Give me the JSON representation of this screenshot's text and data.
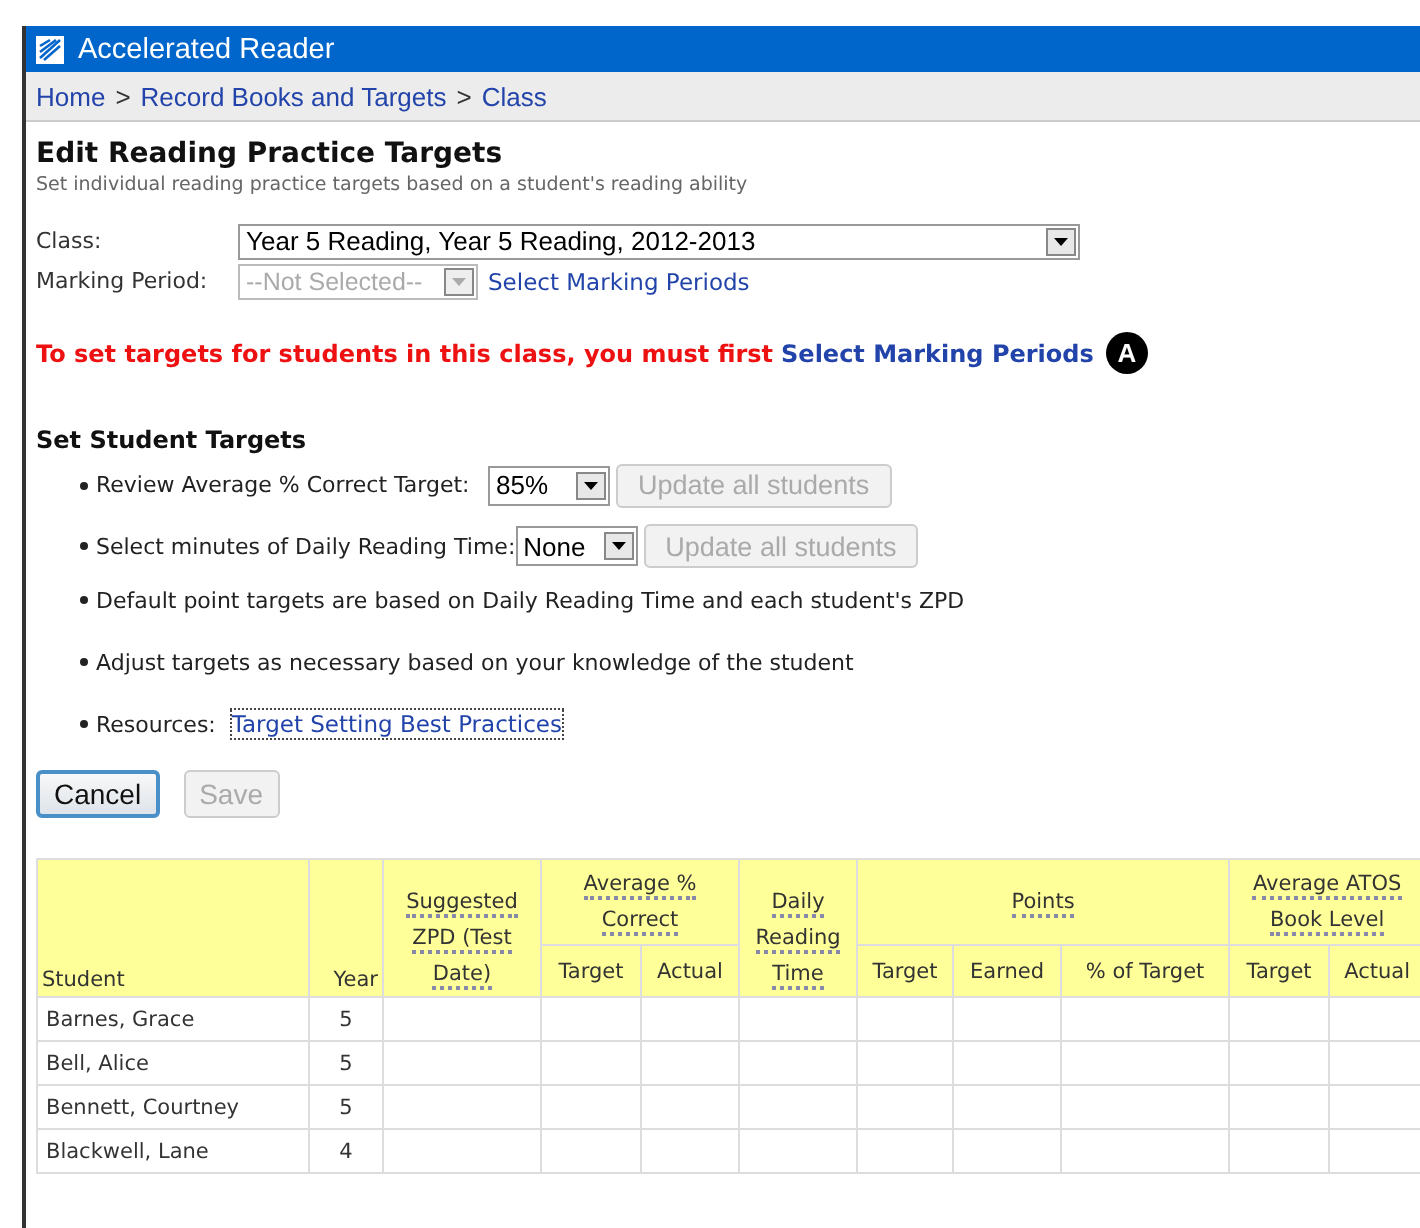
{
  "window": {
    "title": "Accelerated Reader"
  },
  "breadcrumb": [
    "Home",
    "Record Books and Targets",
    "Class"
  ],
  "breadcrumb_separator": ">",
  "heading": "Edit Reading Practice Targets",
  "subheading": "Set individual reading practice targets based on a student's reading ability",
  "class_field": {
    "label": "Class:",
    "value": "Year 5 Reading, Year 5 Reading, 2012-2013",
    "disabled": false
  },
  "marking_period_field": {
    "label": "Marking Period:",
    "value": "--Not Selected--",
    "disabled": true,
    "link": "Select Marking Periods"
  },
  "warning": {
    "text": "To set targets for students in this class, you must first",
    "link": "Select Marking Periods",
    "callout": "A"
  },
  "targets_heading": "Set Student Targets",
  "bullets": [
    {
      "kind": "select",
      "text": "Review Average % Correct Target:",
      "value": "85%",
      "button": "Update all students",
      "button_disabled": true
    },
    {
      "kind": "select",
      "text": "Select minutes of Daily Reading Time:",
      "value": "None",
      "button": "Update all students",
      "button_disabled": true
    },
    {
      "kind": "text",
      "text": "Default point targets are based on Daily Reading Time and each student's ZPD"
    },
    {
      "kind": "text",
      "text": "Adjust targets as necessary based on your knowledge of the student"
    },
    {
      "kind": "link",
      "text": "Resources:",
      "link": "Target Setting Best Practices"
    }
  ],
  "buttons": [
    {
      "label": "Cancel",
      "disabled": false,
      "selected": true
    },
    {
      "label": "Save",
      "disabled": true,
      "selected": false
    }
  ],
  "table": {
    "columns": [
      {
        "label": "Student"
      },
      {
        "label": "Year"
      },
      {
        "label": "Suggested ZPD (Test Date)"
      },
      {
        "label": "Average % Correct",
        "children": [
          "Target",
          "Actual"
        ]
      },
      {
        "label": "Daily Reading Time"
      },
      {
        "label": "Points",
        "children": [
          "Target",
          "Earned",
          "% of Target"
        ]
      },
      {
        "label": "Average ATOS Book Level",
        "children": [
          "Target",
          "Actual"
        ]
      }
    ],
    "rows": [
      {
        "student": "Barnes, Grace",
        "year": "5"
      },
      {
        "student": "Bell, Alice",
        "year": "5"
      },
      {
        "student": "Bennett, Courtney",
        "year": "5"
      },
      {
        "student": "Blackwell, Lane",
        "year": "4"
      }
    ]
  }
}
